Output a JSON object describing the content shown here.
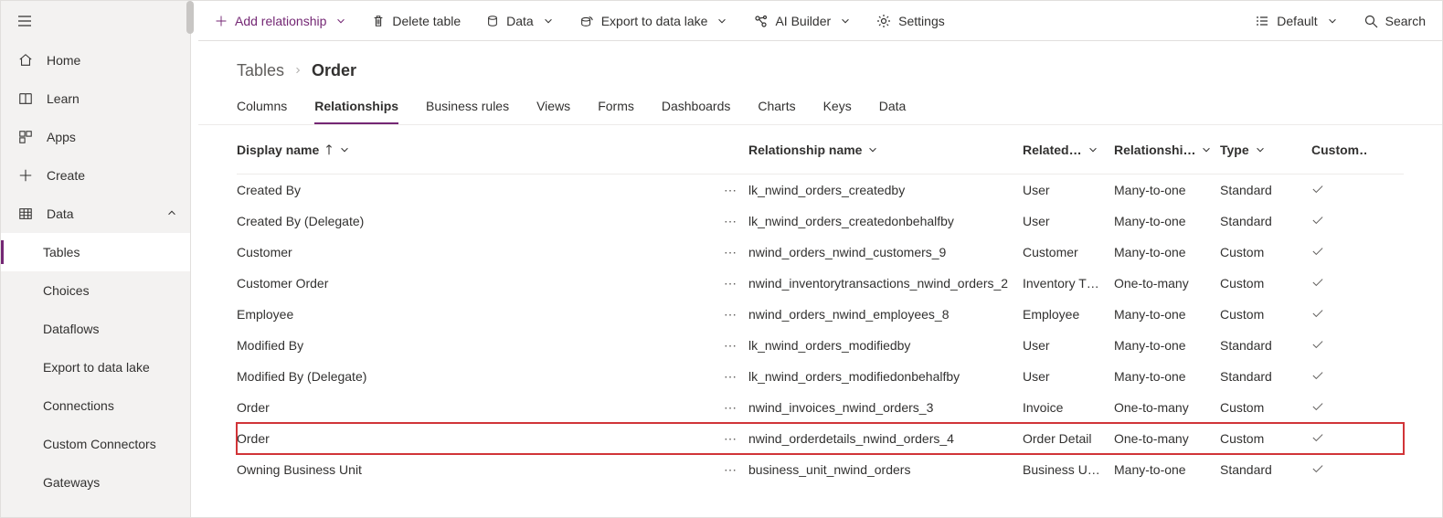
{
  "sidebar": {
    "items": [
      {
        "label": "Home",
        "icon": "home"
      },
      {
        "label": "Learn",
        "icon": "book"
      },
      {
        "label": "Apps",
        "icon": "apps"
      },
      {
        "label": "Create",
        "icon": "plus"
      },
      {
        "label": "Data",
        "icon": "grid",
        "expandable": true,
        "expanded": true
      }
    ],
    "sub_items": [
      {
        "label": "Tables",
        "active": true
      },
      {
        "label": "Choices"
      },
      {
        "label": "Dataflows"
      },
      {
        "label": "Export to data lake"
      },
      {
        "label": "Connections"
      },
      {
        "label": "Custom Connectors"
      },
      {
        "label": "Gateways"
      }
    ]
  },
  "command_bar": {
    "add_relationship": "Add relationship",
    "delete_table": "Delete table",
    "data": "Data",
    "export": "Export to data lake",
    "ai_builder": "AI Builder",
    "settings": "Settings",
    "default": "Default",
    "search": "Search"
  },
  "breadcrumb": {
    "root": "Tables",
    "current": "Order"
  },
  "tabs": [
    "Columns",
    "Relationships",
    "Business rules",
    "Views",
    "Forms",
    "Dashboards",
    "Charts",
    "Keys",
    "Data"
  ],
  "active_tab": "Relationships",
  "columns": {
    "display_name": "Display name",
    "relationship_name": "Relationship name",
    "related": "Related…",
    "relationship_type": "Relationshi…",
    "type": "Type",
    "custom": "Custom…"
  },
  "rows": [
    {
      "display": "Created By",
      "rel": "lk_nwind_orders_createdby",
      "related": "User",
      "rtype": "Many-to-one",
      "type": "Standard",
      "custom": true
    },
    {
      "display": "Created By (Delegate)",
      "rel": "lk_nwind_orders_createdonbehalfby",
      "related": "User",
      "rtype": "Many-to-one",
      "type": "Standard",
      "custom": true
    },
    {
      "display": "Customer",
      "rel": "nwind_orders_nwind_customers_9",
      "related": "Customer",
      "rtype": "Many-to-one",
      "type": "Custom",
      "custom": true
    },
    {
      "display": "Customer Order",
      "rel": "nwind_inventorytransactions_nwind_orders_2",
      "related": "Inventory T…",
      "rtype": "One-to-many",
      "type": "Custom",
      "custom": true
    },
    {
      "display": "Employee",
      "rel": "nwind_orders_nwind_employees_8",
      "related": "Employee",
      "rtype": "Many-to-one",
      "type": "Custom",
      "custom": true
    },
    {
      "display": "Modified By",
      "rel": "lk_nwind_orders_modifiedby",
      "related": "User",
      "rtype": "Many-to-one",
      "type": "Standard",
      "custom": true
    },
    {
      "display": "Modified By (Delegate)",
      "rel": "lk_nwind_orders_modifiedonbehalfby",
      "related": "User",
      "rtype": "Many-to-one",
      "type": "Standard",
      "custom": true
    },
    {
      "display": "Order",
      "rel": "nwind_invoices_nwind_orders_3",
      "related": "Invoice",
      "rtype": "One-to-many",
      "type": "Custom",
      "custom": true
    },
    {
      "display": "Order",
      "rel": "nwind_orderdetails_nwind_orders_4",
      "related": "Order Detail",
      "rtype": "One-to-many",
      "type": "Custom",
      "custom": true,
      "highlight": true
    },
    {
      "display": "Owning Business Unit",
      "rel": "business_unit_nwind_orders",
      "related": "Business U…",
      "rtype": "Many-to-one",
      "type": "Standard",
      "custom": true
    }
  ]
}
